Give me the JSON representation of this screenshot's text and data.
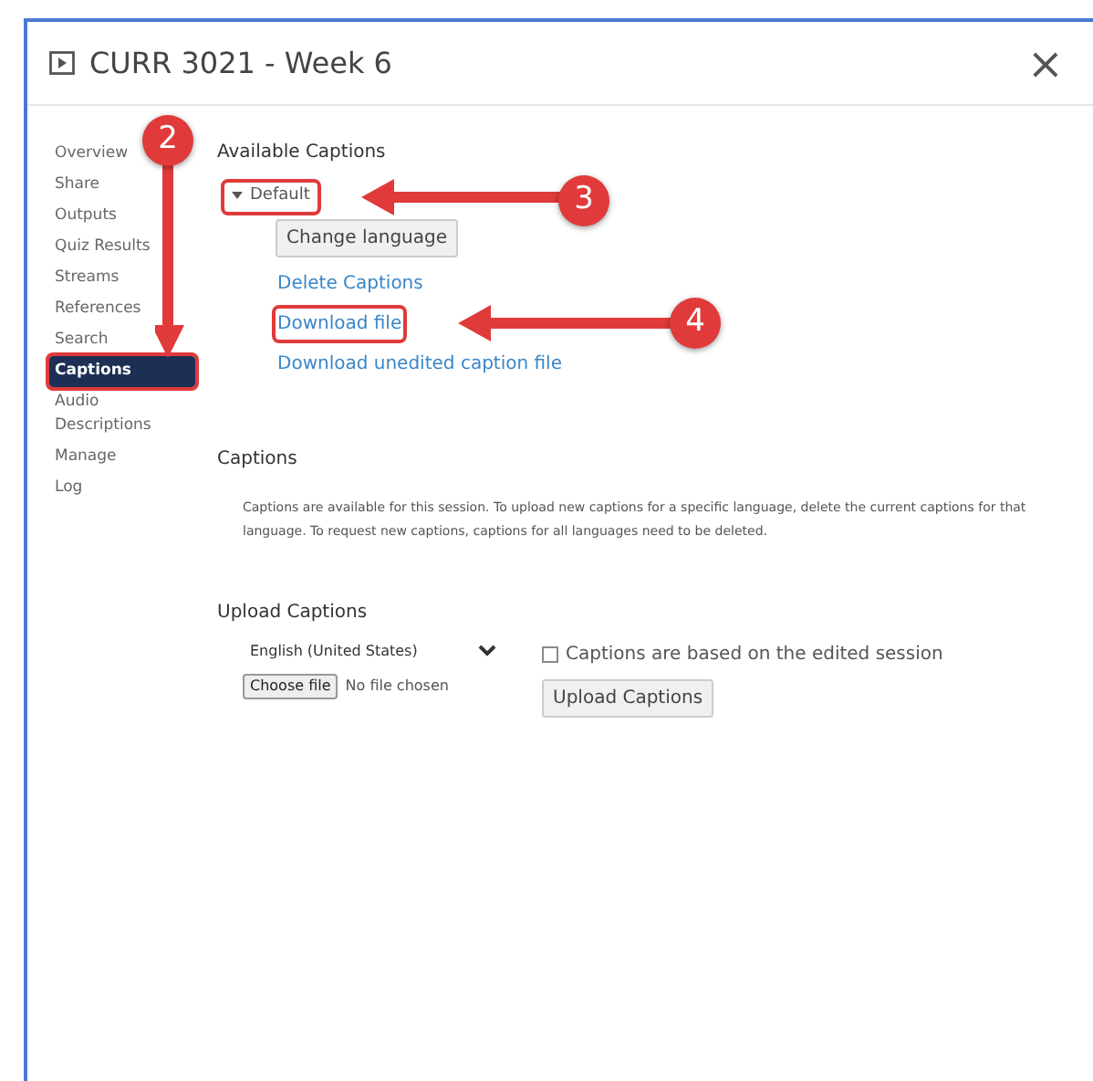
{
  "window": {
    "title": "CURR 3021 - Week 6",
    "close": "×"
  },
  "sidebar": {
    "items": [
      {
        "label": "Overview",
        "selected": false,
        "highlighted": false
      },
      {
        "label": "Share",
        "selected": false,
        "highlighted": false
      },
      {
        "label": "Outputs",
        "selected": false,
        "highlighted": false
      },
      {
        "label": "Quiz Results",
        "selected": false,
        "highlighted": false
      },
      {
        "label": "Streams",
        "selected": false,
        "highlighted": false
      },
      {
        "label": "References",
        "selected": false,
        "highlighted": false
      },
      {
        "label": "Search",
        "selected": false,
        "highlighted": false
      },
      {
        "label": "Captions",
        "selected": true,
        "highlighted": true
      },
      {
        "label": "Audio Descriptions",
        "selected": false,
        "highlighted": false
      },
      {
        "label": "Manage",
        "selected": false,
        "highlighted": false
      },
      {
        "label": "Log",
        "selected": false,
        "highlighted": false
      }
    ]
  },
  "available_captions": {
    "heading": "Available Captions",
    "language": {
      "label": "Default",
      "expanded": true,
      "highlighted": true
    },
    "change_button": "Change language",
    "links": [
      {
        "label": "Delete Captions",
        "highlighted": false
      },
      {
        "label": "Download file",
        "highlighted": true
      },
      {
        "label": "Download unedited caption file",
        "highlighted": false
      }
    ]
  },
  "captions": {
    "heading": "Captions",
    "text": "Captions are available for this session. To upload new captions for a specific language, delete the current captions for that language. To request new captions, captions for all languages need to be deleted."
  },
  "upload": {
    "heading": "Upload Captions",
    "language_select": "English (United States)",
    "file_button": "Choose file",
    "file_status": "No file chosen",
    "checkbox": {
      "label": "Captions are based on the edited session",
      "checked": false
    },
    "upload_button": "Upload Captions"
  },
  "callouts": [
    {
      "number": "2"
    },
    {
      "number": "3"
    },
    {
      "number": "4"
    }
  ]
}
